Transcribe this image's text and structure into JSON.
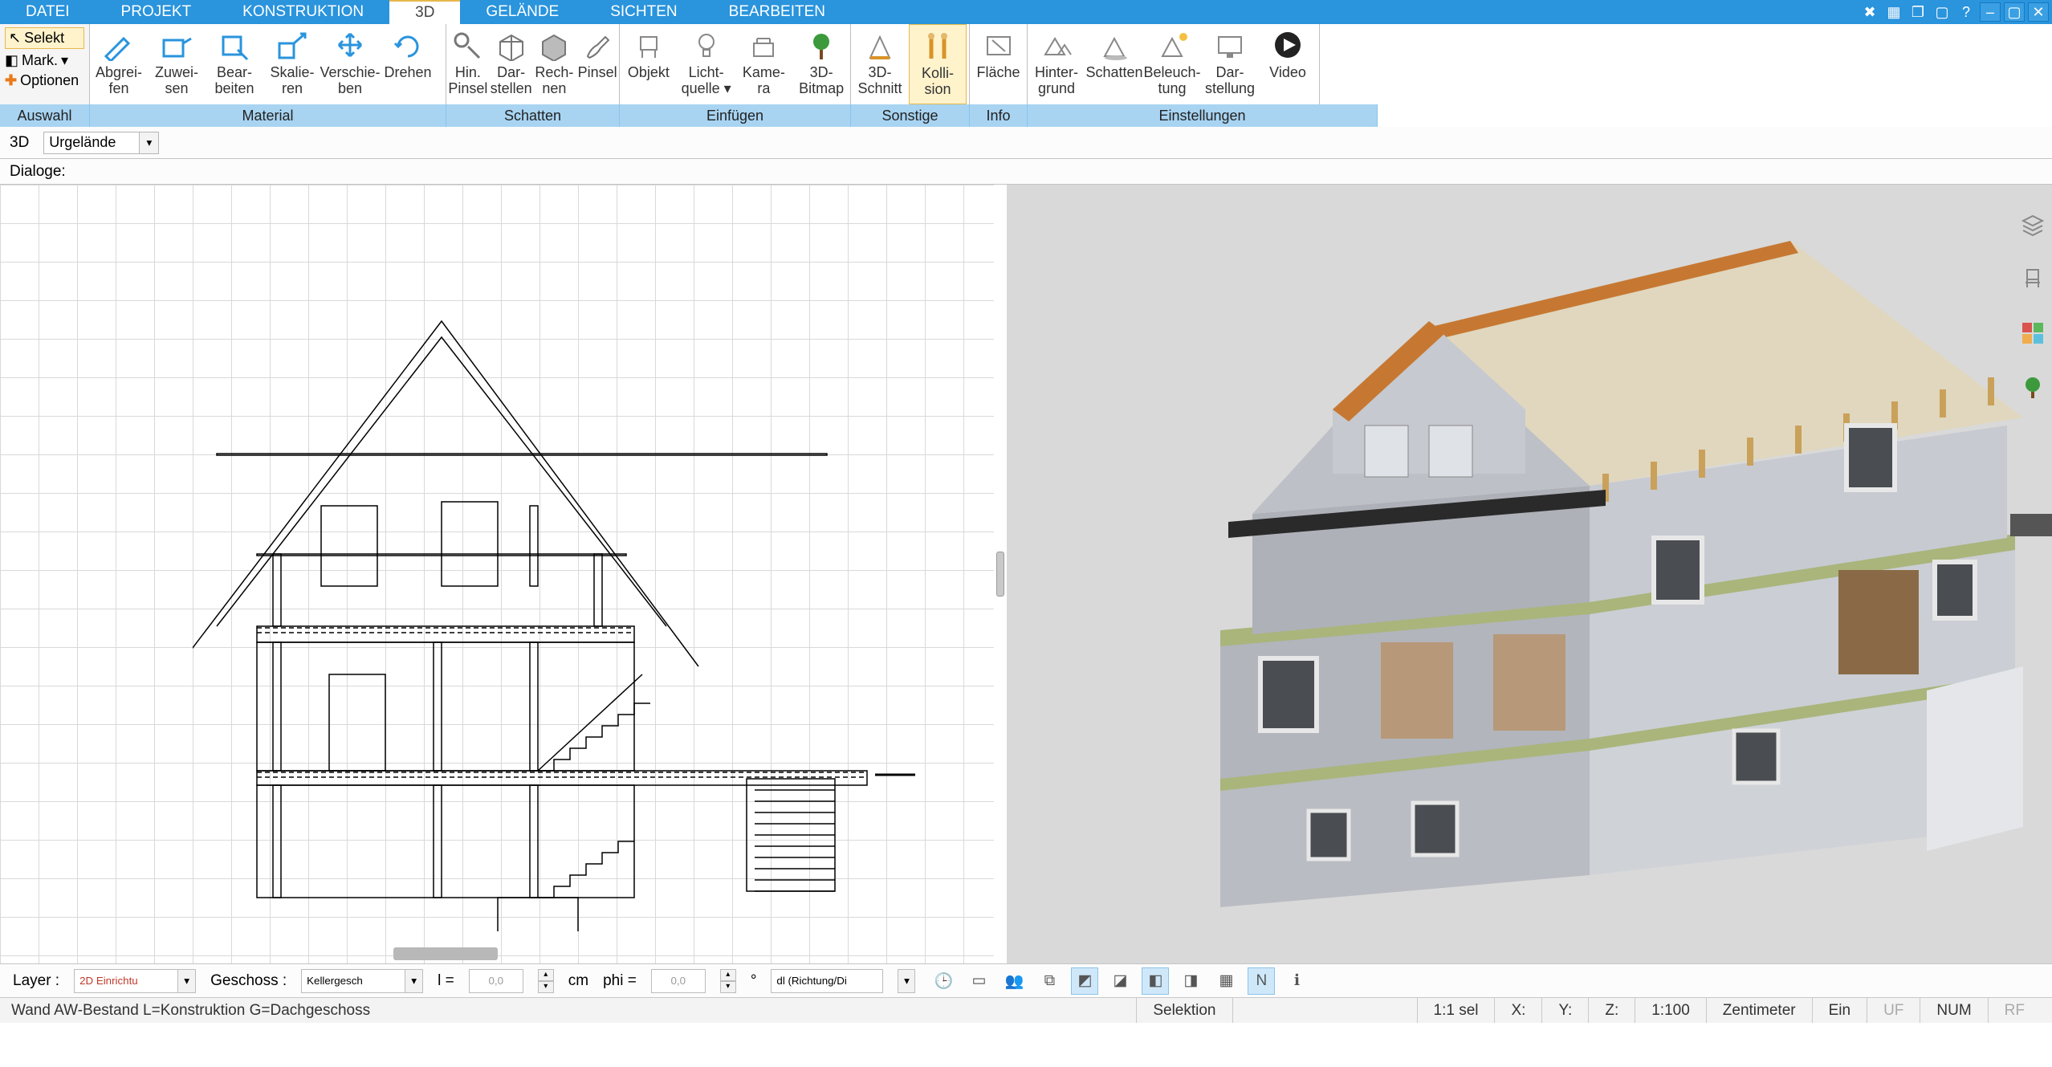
{
  "menu": {
    "items": [
      "DATEI",
      "PROJEKT",
      "KONSTRUKTION",
      "3D",
      "GELÄNDE",
      "SICHTEN",
      "BEARBEITEN"
    ],
    "active_index": 3
  },
  "titlebar_icons": [
    "tools",
    "tab",
    "window",
    "screen",
    "help",
    "min",
    "max",
    "close"
  ],
  "selection": {
    "selekt": "Selekt",
    "mark": "Mark.",
    "optionen": "Optionen",
    "group_label": "Auswahl"
  },
  "ribbon": {
    "groups": [
      {
        "key": "mat",
        "label": "Material",
        "buttons": [
          {
            "label1": "Abgrei-",
            "label2": "fen",
            "icon": "pipette"
          },
          {
            "label1": "Zuwei-",
            "label2": "sen",
            "icon": "bucket"
          },
          {
            "label1": "Bear-",
            "label2": "beiten",
            "icon": "edit"
          },
          {
            "label1": "Skalie-",
            "label2": "ren",
            "icon": "scale"
          },
          {
            "label1": "Verschie-",
            "label2": "ben",
            "icon": "move"
          },
          {
            "label1": "Drehen",
            "label2": "",
            "icon": "rotate"
          }
        ]
      },
      {
        "key": "sch",
        "label": "Schatten",
        "buttons": [
          {
            "label1": "Hin.",
            "label2": "Pinsel",
            "icon": "brush-add"
          },
          {
            "label1": "Dar-",
            "label2": "stellen",
            "icon": "cube"
          },
          {
            "label1": "Rech-",
            "label2": "nen",
            "icon": "cube2"
          },
          {
            "label1": "Pinsel",
            "label2": "",
            "icon": "brush"
          }
        ],
        "start": 1
      },
      {
        "key": "ein",
        "label": "Einfügen",
        "buttons": [
          {
            "label1": "Objekt",
            "label2": "",
            "icon": "chair"
          },
          {
            "label1": "Licht-",
            "label2": "quelle ▾",
            "icon": "bulb"
          },
          {
            "label1": "Kame-",
            "label2": "ra",
            "icon": "camera"
          },
          {
            "label1": "3D-",
            "label2": "Bitmap",
            "icon": "tree"
          }
        ]
      },
      {
        "key": "son",
        "label": "Sonstige",
        "buttons": [
          {
            "label1": "3D-",
            "label2": "Schnitt",
            "icon": "cut"
          },
          {
            "label1": "Kolli-",
            "label2": "sion",
            "icon": "collide",
            "active": true
          }
        ]
      },
      {
        "key": "inf",
        "label": "Info",
        "buttons": [
          {
            "label1": "Fläche",
            "label2": "",
            "icon": "area"
          }
        ]
      },
      {
        "key": "set",
        "label": "Einstellungen",
        "buttons": [
          {
            "label1": "Hinter-",
            "label2": "grund",
            "icon": "bg"
          },
          {
            "label1": "Schatten",
            "label2": "",
            "icon": "shadow"
          },
          {
            "label1": "Beleuch-",
            "label2": "tung",
            "icon": "light"
          },
          {
            "label1": "Dar-",
            "label2": "stellung",
            "icon": "screen"
          }
        ]
      },
      {
        "key": "vid",
        "label": "",
        "buttons": [
          {
            "label1": "Video",
            "label2": "",
            "icon": "play"
          }
        ]
      }
    ]
  },
  "subbar1": {
    "label3d": "3D",
    "terrain": "Urgelände"
  },
  "subbar2": {
    "label": "Dialoge:"
  },
  "bottom": {
    "layer_label": "Layer :",
    "layer_value": "2D Einrichtu",
    "floor_label": "Geschoss :",
    "floor_value": "Kellergesch",
    "l_label": "l =",
    "l_val": "0,0",
    "l_unit": "cm",
    "phi_label": "phi =",
    "phi_val": "0,0",
    "phi_unit": "°",
    "dl": "dl (Richtung/Di"
  },
  "status": {
    "left": "Wand AW-Bestand L=Konstruktion G=Dachgeschoss",
    "selektion": "Selektion",
    "sel": "1:1 sel",
    "x": "X:",
    "y": "Y:",
    "z": "Z:",
    "scale": "1:100",
    "unit": "Zentimeter",
    "ein": "Ein",
    "uf": "UF",
    "num": "NUM",
    "rf": "RF"
  }
}
